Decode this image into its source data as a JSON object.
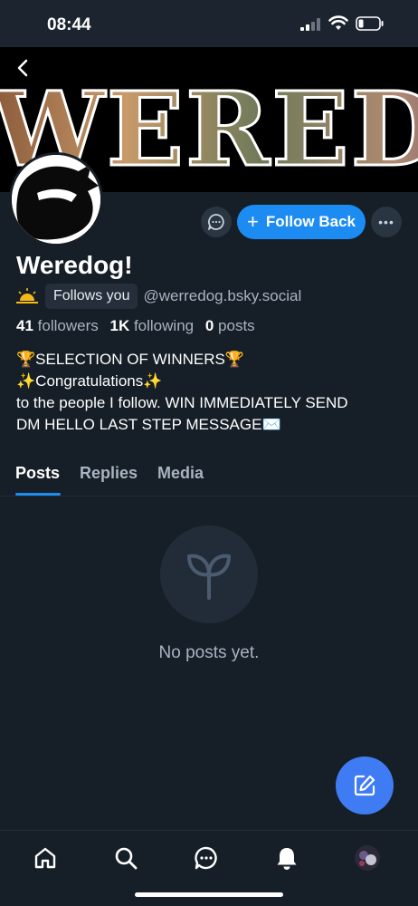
{
  "status_bar": {
    "time": "08:44"
  },
  "banner": {
    "text": "WEREDO"
  },
  "profile": {
    "display_name": "Weredog!",
    "follows_you": "Follows you",
    "handle": "@werredog.bsky.social",
    "followers_count": "41",
    "followers_label": "followers",
    "following_count": "1K",
    "following_label": "following",
    "posts_count": "0",
    "posts_label": "posts",
    "bio": [
      "🏆SELECTION OF WINNERS🏆",
      "✨Congratulations✨",
      "to the people I follow. WIN IMMEDIATELY SEND",
      "DM HELLO LAST STEP MESSAGE✉️"
    ]
  },
  "actions": {
    "follow_back": "Follow Back",
    "more": "•••"
  },
  "tabs": [
    {
      "label": "Posts",
      "active": true
    },
    {
      "label": "Replies",
      "active": false
    },
    {
      "label": "Media",
      "active": false
    }
  ],
  "empty_state": {
    "text": "No posts yet.",
    "icon": "sprout-icon"
  },
  "bottom_nav": [
    {
      "icon": "home-icon"
    },
    {
      "icon": "search-icon"
    },
    {
      "icon": "chat-icon"
    },
    {
      "icon": "bell-icon"
    },
    {
      "icon": "avatar"
    }
  ],
  "colors": {
    "accent": "#1c8cf2",
    "background": "#161e27",
    "fab": "#3f7cf3"
  }
}
